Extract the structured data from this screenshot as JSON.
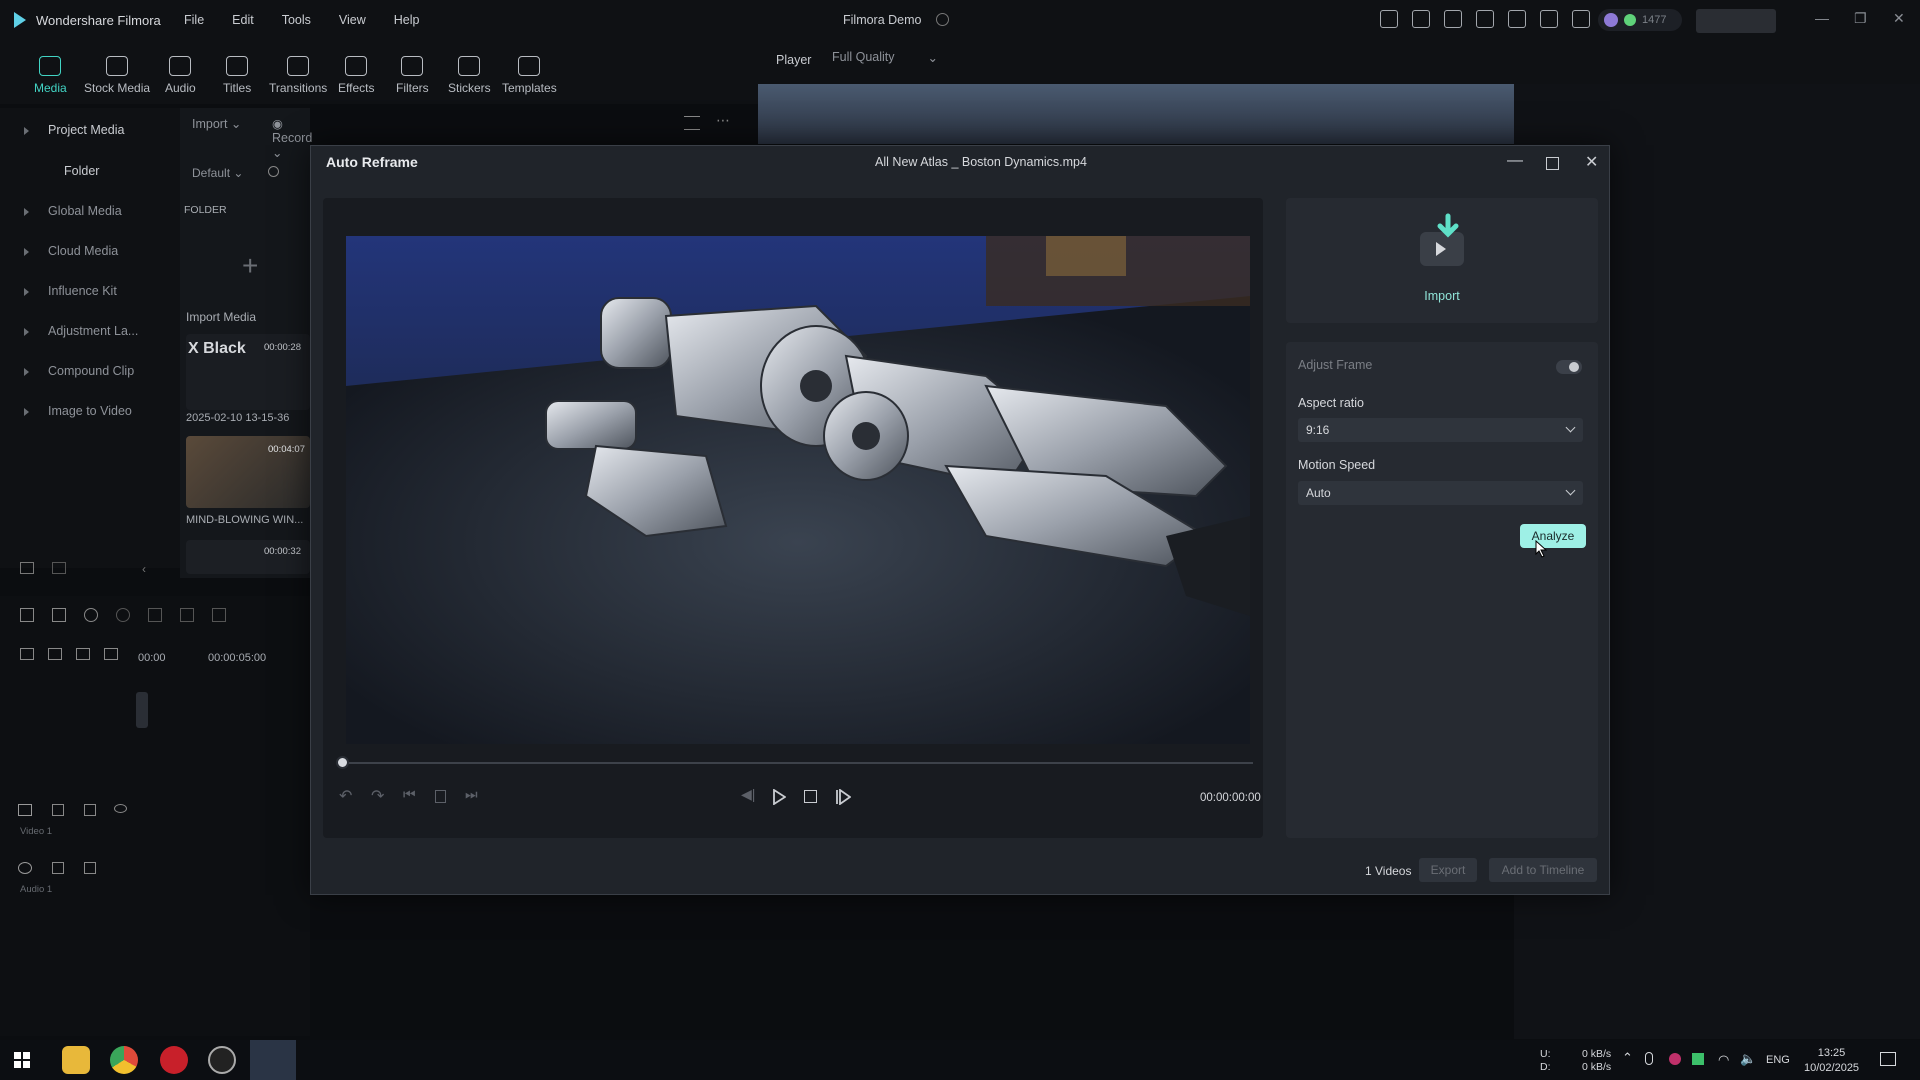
{
  "app": {
    "name": "Wondershare Filmora",
    "project_title": "Filmora Demo",
    "menu": [
      "File",
      "Edit",
      "Tools",
      "View",
      "Help"
    ],
    "credits": "1477"
  },
  "toolbar": {
    "tools": [
      "Media",
      "Stock Media",
      "Audio",
      "Titles",
      "Transitions",
      "Effects",
      "Filters",
      "Stickers",
      "Templates"
    ],
    "player_label": "Player",
    "quality": "Full Quality"
  },
  "sidebar": {
    "items": [
      "Project Media",
      "Folder",
      "Global Media",
      "Cloud Media",
      "Influence Kit",
      "Adjustment La...",
      "Compound Clip",
      "Image to Video"
    ]
  },
  "media_panel": {
    "import_btn": "Import",
    "record_btn": "Record",
    "sort": "Default",
    "folder_label": "FOLDER",
    "import_media": "Import Media",
    "clip1_title": "X Black",
    "clip1_duration": "00:00:28",
    "clip1_date": "2025-02-10 13-15-36",
    "clip2_duration": "00:04:07",
    "clip2_name": "MIND-BLOWING WIN...",
    "clip3_duration": "00:00:32"
  },
  "timeline": {
    "ruler_start": "00:00",
    "ruler_mark": "00:00:05:00",
    "track_video": "Video 1",
    "track_audio": "Audio 1"
  },
  "modal": {
    "title": "Auto Reframe",
    "filename": "All New Atlas _ Boston Dynamics.mp4",
    "timecode": "00:00:00:00",
    "playhead_fraction": 0,
    "import_label": "Import",
    "adjust_frame": "Adjust Frame",
    "aspect_ratio_label": "Aspect ratio",
    "aspect_ratio_value": "9:16",
    "motion_speed_label": "Motion Speed",
    "motion_speed_value": "Auto",
    "analyze_btn": "Analyze",
    "video_count": "1 Videos",
    "export_btn": "Export",
    "add_timeline_btn": "Add to Timeline"
  },
  "taskbar": {
    "upload_label": "U:",
    "download_label": "D:",
    "upload_rate": "0 kB/s",
    "download_rate": "0 kB/s",
    "lang": "ENG",
    "time": "13:25",
    "date": "10/02/2025"
  },
  "colors": {
    "accent": "#42d4c4",
    "analyze_bg": "#9ef0e6",
    "modal_bg": "#20242a"
  }
}
